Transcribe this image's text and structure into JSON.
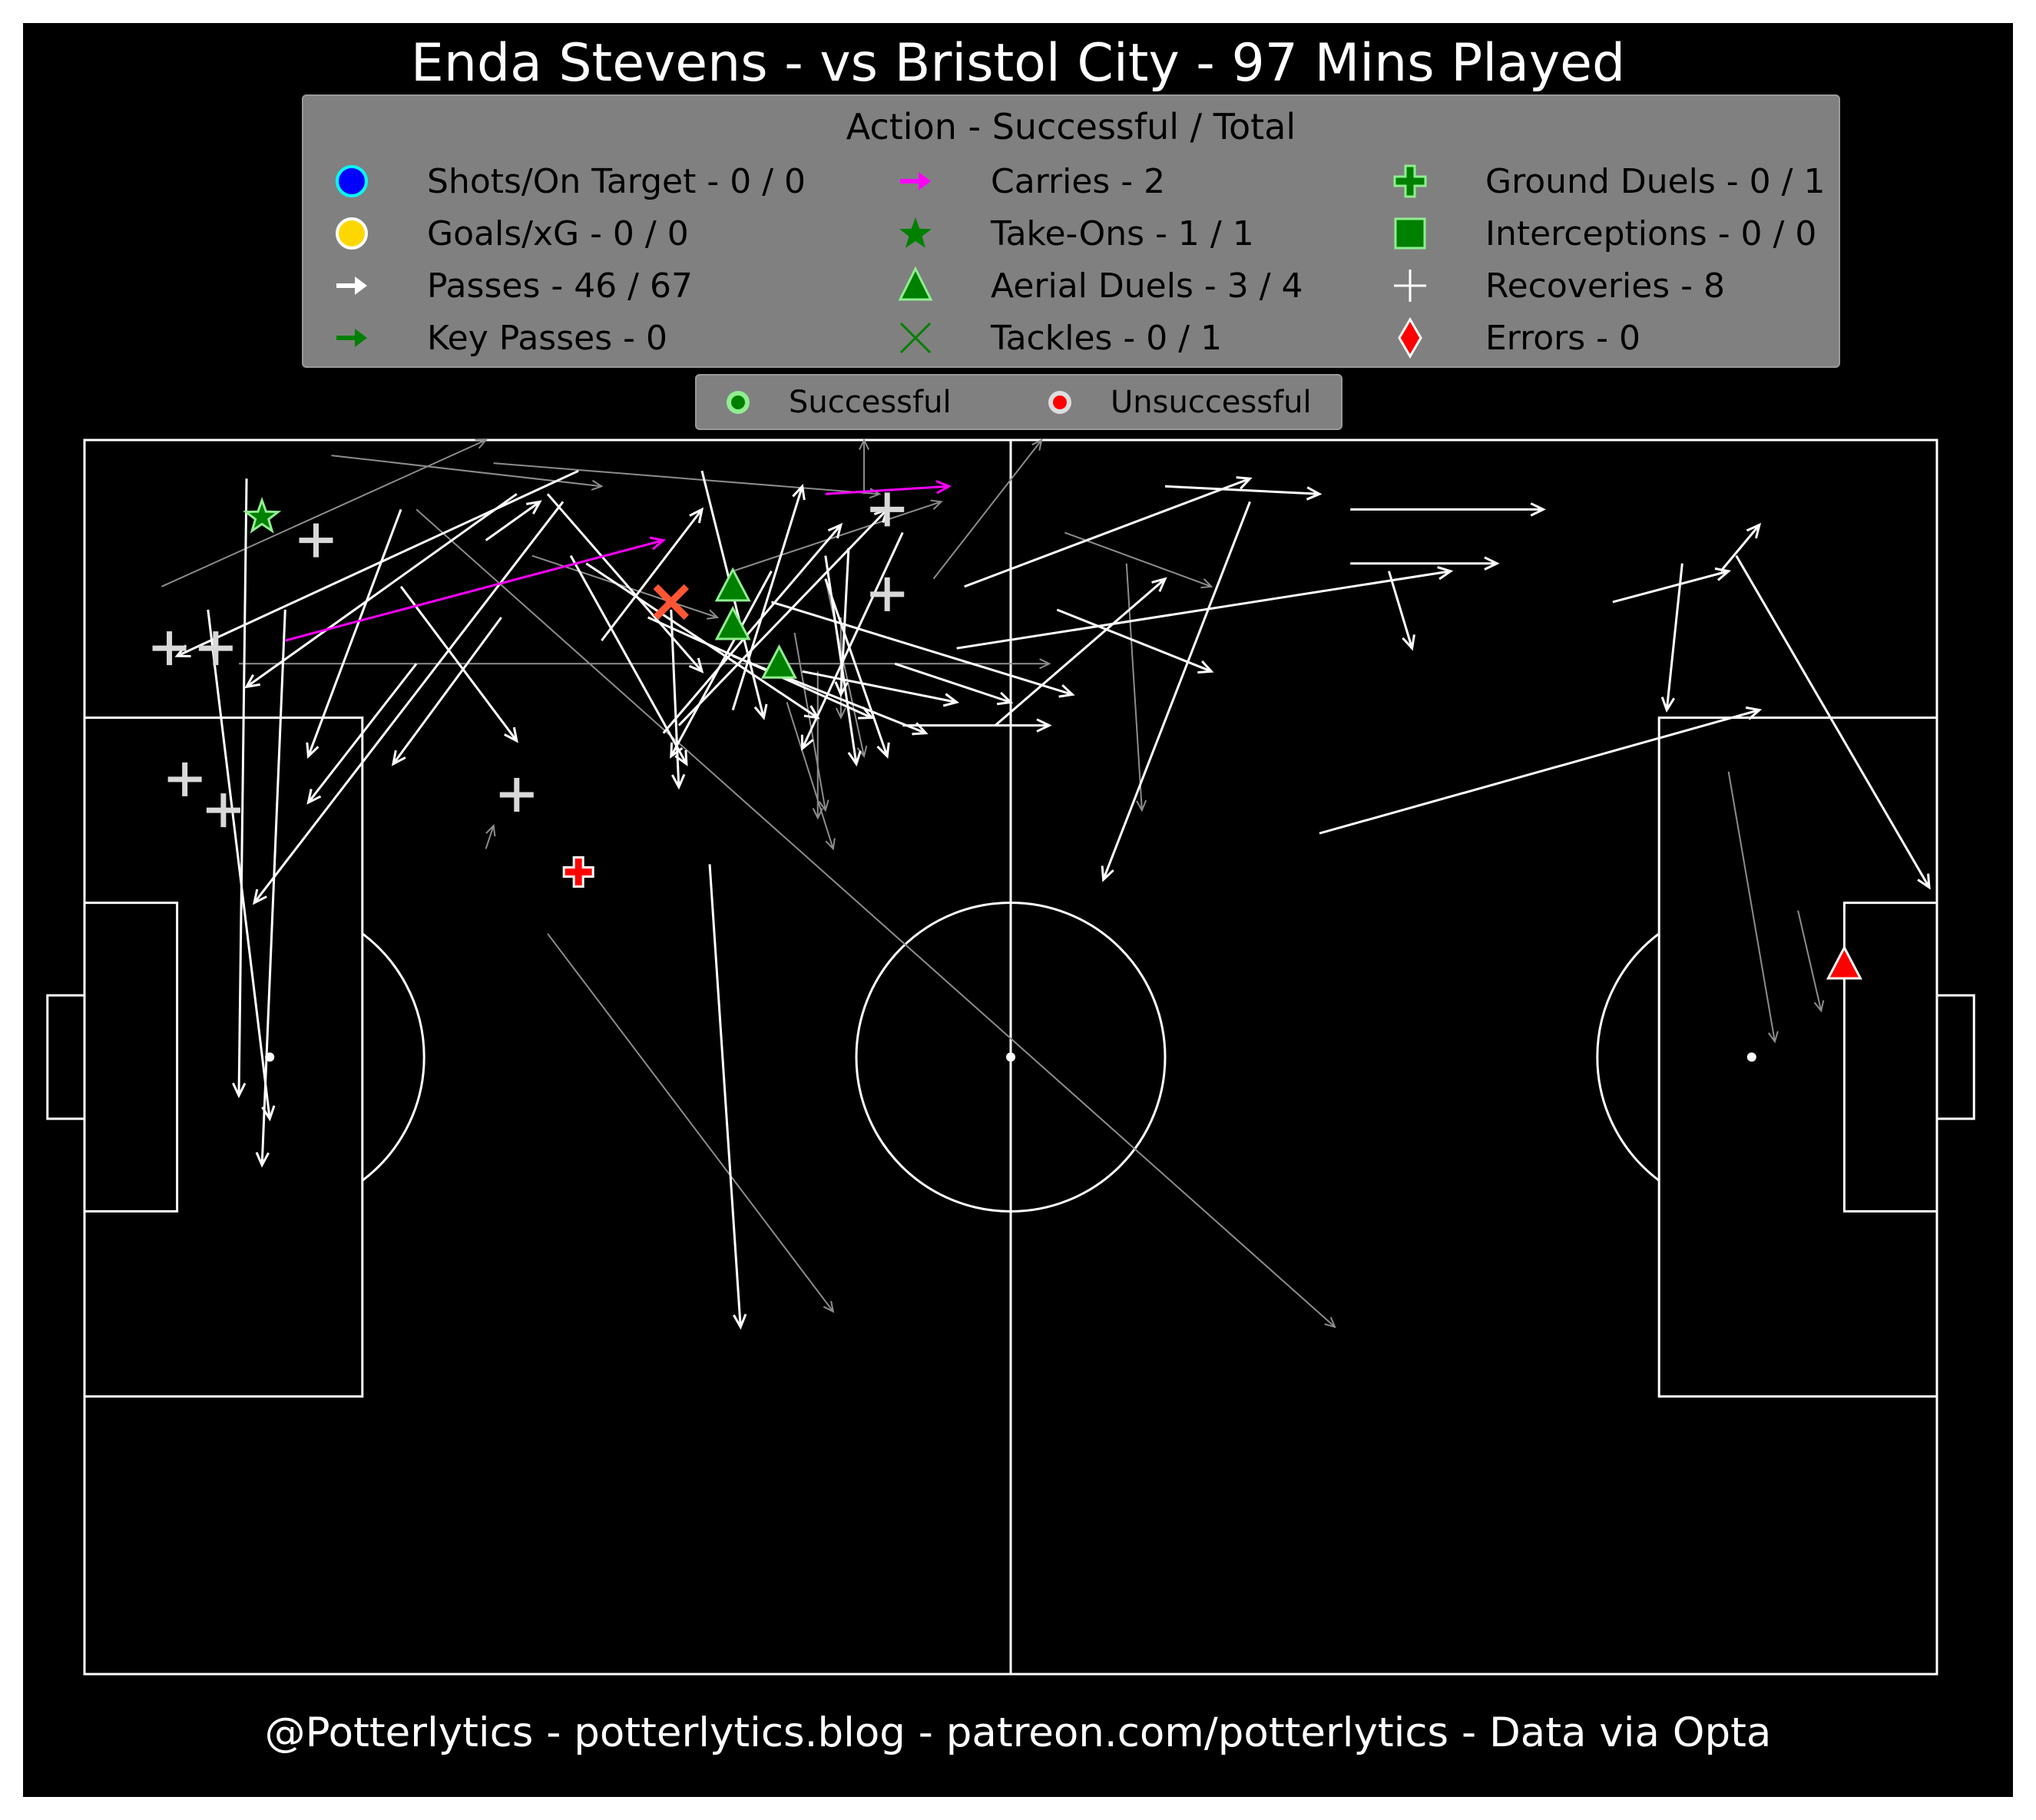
{
  "title": "Enda Stevens - vs Bristol City - 97 Mins Played",
  "footer": "@Potterlytics - potterlytics.blog - patreon.com/potterlytics - Data via Opta",
  "legend": {
    "title": "Action - Successful / Total",
    "items": [
      {
        "label": "Shots/On Target - 0 / 0",
        "icon": "circle",
        "color": "#0000ff",
        "edge": "#00ffff"
      },
      {
        "label": "Goals/xG - 0 / 0",
        "icon": "circle",
        "color": "#ffd700",
        "edge": "#ffffff"
      },
      {
        "label": "Passes - 46 / 67",
        "icon": "arrow",
        "color": "#ffffff"
      },
      {
        "label": "Key Passes - 0",
        "icon": "arrow",
        "color": "#008000"
      },
      {
        "label": "Carries - 2",
        "icon": "arrow",
        "color": "#ff00ff"
      },
      {
        "label": "Take-Ons - 1 / 1",
        "icon": "star",
        "color": "#008000"
      },
      {
        "label": "Aerial Duels - 3 / 4",
        "icon": "triangle",
        "color": "#008000",
        "edge": "#90ee90"
      },
      {
        "label": "Tackles - 0 / 1",
        "icon": "x",
        "color": "#008000"
      },
      {
        "label": "Ground Duels - 0 / 1",
        "icon": "plus",
        "color": "#008000",
        "edge": "#90ee90"
      },
      {
        "label": "Interceptions - 0 / 0",
        "icon": "square",
        "color": "#008000",
        "edge": "#90ee90"
      },
      {
        "label": "Recoveries - 8",
        "icon": "thin-plus",
        "color": "#ffffff"
      },
      {
        "label": "Errors - 0",
        "icon": "diamond",
        "color": "#ff0000",
        "edge": "#ffffff"
      }
    ]
  },
  "outcome_legend": {
    "successful_label": "Successful",
    "unsuccessful_label": "Unsuccessful",
    "successful_color": "#008000",
    "unsuccessful_color": "#ff0000"
  },
  "chart_data": {
    "type": "scatter",
    "pitch": {
      "length": 120,
      "width": 80,
      "grid": false,
      "background": "#000000",
      "line_color": "#ffffff"
    },
    "passes_successful": [
      [
        10.5,
        2.5,
        10.0,
        42.5
      ],
      [
        20.5,
        4.5,
        14.5,
        20.5
      ],
      [
        28.0,
        3.5,
        10.5,
        16.0
      ],
      [
        32.0,
        2.0,
        6.0,
        14.0
      ],
      [
        31.0,
        4.0,
        11.0,
        30.0
      ],
      [
        20.5,
        9.5,
        28.0,
        19.5
      ],
      [
        26.0,
        6.5,
        29.5,
        4.0
      ],
      [
        32.5,
        8.0,
        47.5,
        18.0
      ],
      [
        30.0,
        3.5,
        40.0,
        15.0
      ],
      [
        40.0,
        2.0,
        44.0,
        18.0
      ],
      [
        36.5,
        11.5,
        51.0,
        18.0
      ],
      [
        33.5,
        13.0,
        40.0,
        4.5
      ],
      [
        31.5,
        7.5,
        39.0,
        21.0
      ],
      [
        44.5,
        8.5,
        38.0,
        20.5
      ],
      [
        53.0,
        6.0,
        46.5,
        20.0
      ],
      [
        48.0,
        9.0,
        52.0,
        20.5
      ],
      [
        48.0,
        7.5,
        50.0,
        21.0
      ],
      [
        49.5,
        7.0,
        49.0,
        16.5
      ],
      [
        42.0,
        14.0,
        54.5,
        19.0
      ],
      [
        46.5,
        15.0,
        56.5,
        17.0
      ],
      [
        44.5,
        10.5,
        64.0,
        16.5
      ],
      [
        53.0,
        18.5,
        62.5,
        18.5
      ],
      [
        52.5,
        14.5,
        60.0,
        17.0
      ],
      [
        42.0,
        17.5,
        46.5,
        3.0
      ],
      [
        37.5,
        19.0,
        49.0,
        5.5
      ],
      [
        38.5,
        18.5,
        52.0,
        4.5
      ],
      [
        63.0,
        11.0,
        73.0,
        15.0
      ],
      [
        57.0,
        9.5,
        75.5,
        2.5
      ],
      [
        59.0,
        18.5,
        70.0,
        9.0
      ],
      [
        75.5,
        4.0,
        66.0,
        28.5
      ],
      [
        56.5,
        13.5,
        88.5,
        8.5
      ],
      [
        70.0,
        3.0,
        80.0,
        3.5
      ],
      [
        82.0,
        4.5,
        94.5,
        4.5
      ],
      [
        82.0,
        8.0,
        91.5,
        8.0
      ],
      [
        84.5,
        8.5,
        86.0,
        13.5
      ],
      [
        99.0,
        10.5,
        106.5,
        8.5
      ],
      [
        106.0,
        8.5,
        108.5,
        5.5
      ],
      [
        103.5,
        8.0,
        102.5,
        17.5
      ],
      [
        80.0,
        25.5,
        108.5,
        17.5
      ],
      [
        107.0,
        7.5,
        119.5,
        29.0
      ],
      [
        40.5,
        27.5,
        42.5,
        57.5
      ],
      [
        13.0,
        11.0,
        11.5,
        47.0
      ],
      [
        8.0,
        11.0,
        12.0,
        44.0
      ],
      [
        27.0,
        11.5,
        20.0,
        21.0
      ],
      [
        38.0,
        11.0,
        38.5,
        22.5
      ],
      [
        21.5,
        14.5,
        14.5,
        23.5
      ]
    ],
    "passes_unsuccessful": [
      [
        5.0,
        9.5,
        26.0,
        0.0
      ],
      [
        16.0,
        1.0,
        33.5,
        3.0
      ],
      [
        29.0,
        7.5,
        41.0,
        11.5
      ],
      [
        26.5,
        1.5,
        51.5,
        3.5
      ],
      [
        42.0,
        8.5,
        55.5,
        4.0
      ],
      [
        50.5,
        3.5,
        50.5,
        0.0
      ],
      [
        48.0,
        9.0,
        50.5,
        20.5
      ],
      [
        46.0,
        12.5,
        48.0,
        24.0
      ],
      [
        49.0,
        11.5,
        49.0,
        18.0
      ],
      [
        47.5,
        15.0,
        47.5,
        24.5
      ],
      [
        10.0,
        14.5,
        62.5,
        14.5
      ],
      [
        21.5,
        4.5,
        81.0,
        57.5
      ],
      [
        30.0,
        32.0,
        48.5,
        56.5
      ],
      [
        45.5,
        17.0,
        48.5,
        26.5
      ],
      [
        63.5,
        6.0,
        73.0,
        9.5
      ],
      [
        67.5,
        8.0,
        68.5,
        24.0
      ],
      [
        55.0,
        9.0,
        62.0,
        0.0
      ],
      [
        106.5,
        21.5,
        109.5,
        39.0
      ],
      [
        111.0,
        30.5,
        112.5,
        37.0
      ],
      [
        26.0,
        26.5,
        26.5,
        25.0
      ]
    ],
    "carries": [
      [
        13.0,
        13.0,
        37.5,
        6.5
      ],
      [
        48.0,
        3.5,
        56.0,
        3.0
      ]
    ],
    "take_ons": {
      "successful": [
        [
          11.5,
          5.0
        ]
      ],
      "unsuccessful": []
    },
    "aerial_duels": {
      "successful": [
        [
          42.0,
          9.5
        ],
        [
          42.0,
          12.0
        ],
        [
          45.0,
          14.5
        ]
      ],
      "unsuccessful": [
        [
          114.0,
          34.0
        ]
      ]
    },
    "tackles": {
      "successful": [],
      "unsuccessful": [
        [
          38.0,
          10.5
        ]
      ]
    },
    "ground_duels": {
      "successful": [],
      "unsuccessful": [
        [
          32.0,
          28.0
        ]
      ]
    },
    "recoveries": [
      [
        15.0,
        6.5
      ],
      [
        5.5,
        13.5
      ],
      [
        8.5,
        13.5
      ],
      [
        6.5,
        22.0
      ],
      [
        9.0,
        24.0
      ],
      [
        28.0,
        23.0
      ],
      [
        52.0,
        10.0
      ],
      [
        52.0,
        4.5
      ]
    ],
    "interceptions": [],
    "shots": [],
    "goals": [],
    "errors": []
  }
}
